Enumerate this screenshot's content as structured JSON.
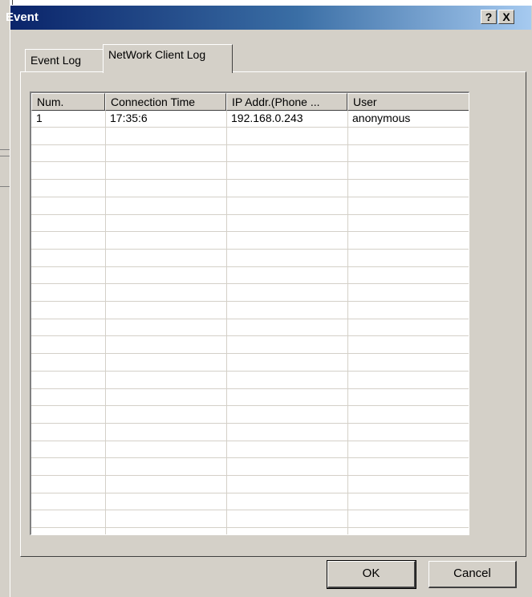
{
  "window": {
    "title": "Event",
    "help_glyph": "?",
    "close_glyph": "X"
  },
  "tabs": [
    {
      "label": "Event Log",
      "active": false
    },
    {
      "label": "NetWork Client Log",
      "active": true
    }
  ],
  "table": {
    "columns": [
      "Num.",
      "Connection Time",
      "IP Addr.(Phone ...",
      "User"
    ],
    "rows": [
      [
        "1",
        "17:35:6",
        "192.168.0.243",
        "anonymous"
      ]
    ]
  },
  "buttons": {
    "ok": "OK",
    "cancel": "Cancel"
  }
}
